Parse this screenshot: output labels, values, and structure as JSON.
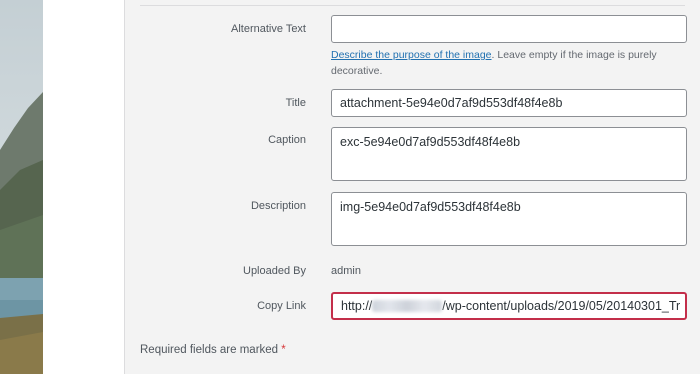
{
  "fields": {
    "alt_text": {
      "label": "Alternative Text",
      "value": "",
      "help_link": "Describe the purpose of the image",
      "help_rest": ". Leave empty if the image is purely decorative."
    },
    "title": {
      "label": "Title",
      "value": "attachment-5e94e0d7af9d553df48f4e8b"
    },
    "caption": {
      "label": "Caption",
      "value": "exc-5e94e0d7af9d553df48f4e8b"
    },
    "description": {
      "label": "Description",
      "value": "img-5e94e0d7af9d553df48f4e8b"
    },
    "uploaded_by": {
      "label": "Uploaded By",
      "value": "admin"
    },
    "copy_link": {
      "label": "Copy Link",
      "value_prefix": "http://",
      "value_suffix": "/wp-content/uploads/2019/05/20140301_Tr"
    }
  },
  "footer": {
    "required_text": "Required fields are marked",
    "asterisk": "*"
  },
  "colors": {
    "panel_bg": "#f3f3f3",
    "link": "#2271b1",
    "highlight_border": "#c32e4a",
    "required": "#d63638"
  }
}
